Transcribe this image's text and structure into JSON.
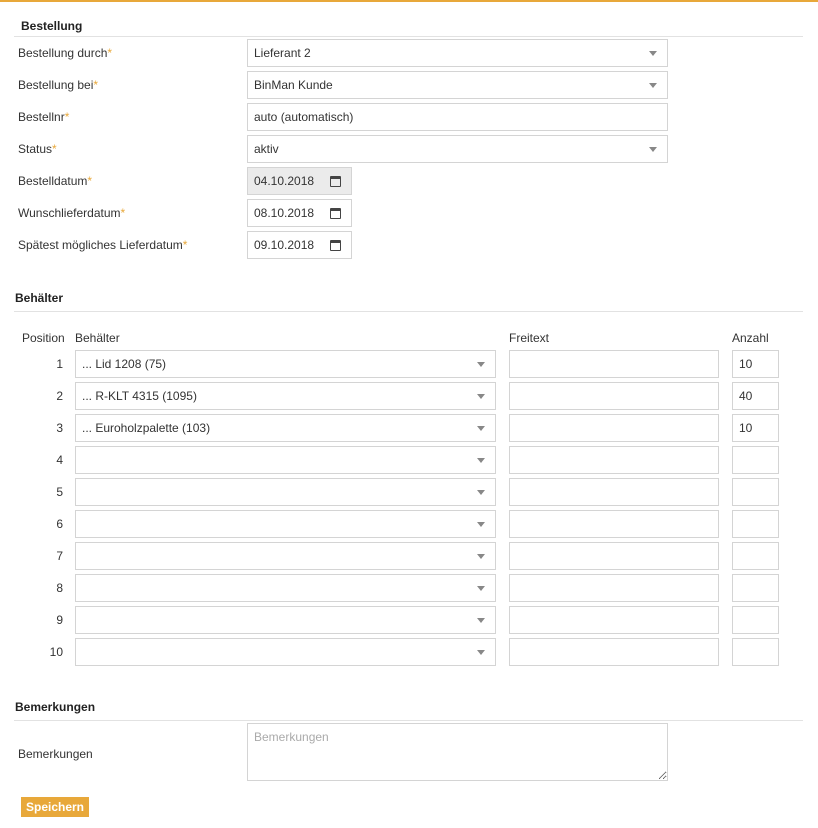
{
  "colors": {
    "accent": "#e8a83a",
    "border": "#d4d4d4",
    "disabled_bg": "#ebebeb"
  },
  "bestellung": {
    "title": "Bestellung",
    "fields": {
      "durch": {
        "label": "Bestellung durch",
        "value": "Lieferant 2"
      },
      "bei": {
        "label": "Bestellung bei",
        "value": "BinMan Kunde"
      },
      "nr": {
        "label": "Bestellnr",
        "value": "auto (automatisch)"
      },
      "status": {
        "label": "Status",
        "value": "aktiv"
      },
      "datum": {
        "label": "Bestelldatum",
        "value": "04.10.2018"
      },
      "wunsch": {
        "label": "Wunschlieferdatum",
        "value": "08.10.2018"
      },
      "spaetest": {
        "label": "Spätest mögliches Lieferdatum",
        "value": "09.10.2018"
      }
    },
    "required_mark": "*"
  },
  "behaelter": {
    "title": "Behälter",
    "headers": {
      "position": "Position",
      "behaelter": "Behälter",
      "freitext": "Freitext",
      "anzahl": "Anzahl"
    },
    "rows": [
      {
        "pos": "1",
        "behaelter": "... Lid 1208 (75)",
        "freitext": "",
        "anzahl": "10"
      },
      {
        "pos": "2",
        "behaelter": "... R-KLT 4315 (1095)",
        "freitext": "",
        "anzahl": "40"
      },
      {
        "pos": "3",
        "behaelter": "... Euroholzpalette (103)",
        "freitext": "",
        "anzahl": "10"
      },
      {
        "pos": "4",
        "behaelter": "",
        "freitext": "",
        "anzahl": ""
      },
      {
        "pos": "5",
        "behaelter": "",
        "freitext": "",
        "anzahl": ""
      },
      {
        "pos": "6",
        "behaelter": "",
        "freitext": "",
        "anzahl": ""
      },
      {
        "pos": "7",
        "behaelter": "",
        "freitext": "",
        "anzahl": ""
      },
      {
        "pos": "8",
        "behaelter": "",
        "freitext": "",
        "anzahl": ""
      },
      {
        "pos": "9",
        "behaelter": "",
        "freitext": "",
        "anzahl": ""
      },
      {
        "pos": "10",
        "behaelter": "",
        "freitext": "",
        "anzahl": ""
      }
    ]
  },
  "bemerkungen": {
    "title": "Bemerkungen",
    "label": "Bemerkungen",
    "placeholder": "Bemerkungen",
    "value": ""
  },
  "actions": {
    "save_label": "Speichern"
  }
}
